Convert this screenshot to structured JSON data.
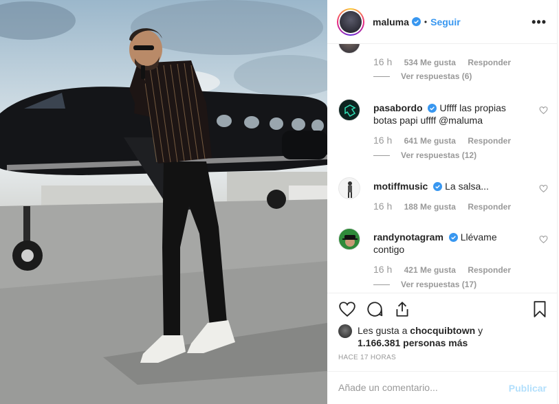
{
  "post": {
    "username": "maluma",
    "separator": "•",
    "follow_label": "Seguir",
    "more_label": "•••"
  },
  "comments": [
    {
      "username": "",
      "text": "",
      "time": "16 h",
      "likes": "534 Me gusta",
      "reply_label": "Responder",
      "view_replies": "Ver respuestas (6)"
    },
    {
      "username": "pasabordo",
      "text": "Uffff las propias botas papi uffff @maluma",
      "time": "16 h",
      "likes": "641 Me gusta",
      "reply_label": "Responder",
      "view_replies": "Ver respuestas (12)"
    },
    {
      "username": "motiffmusic",
      "text": "La salsa...",
      "time": "16 h",
      "likes": "188 Me gusta",
      "reply_label": "Responder",
      "view_replies": ""
    },
    {
      "username": "randynotagram",
      "text": "Llévame contigo",
      "time": "16 h",
      "likes": "421 Me gusta",
      "reply_label": "Responder",
      "view_replies": "Ver respuestas (17)"
    }
  ],
  "likes": {
    "prefix": "Les gusta a",
    "first_user": "chocquibtown",
    "joiner": "y",
    "count_text": "1.166.381 personas más"
  },
  "timestamp": "HACE 17 HORAS",
  "add_comment": {
    "placeholder": "Añade un comentario...",
    "publish_label": "Publicar"
  },
  "icons": {
    "verified": "verified-badge-icon",
    "like": "heart-icon",
    "comment": "comment-icon",
    "share": "share-icon",
    "save": "bookmark-icon"
  },
  "colors": {
    "link_blue": "#3897f0",
    "publish_disabled": "#b2dffc",
    "muted": "#999999"
  }
}
